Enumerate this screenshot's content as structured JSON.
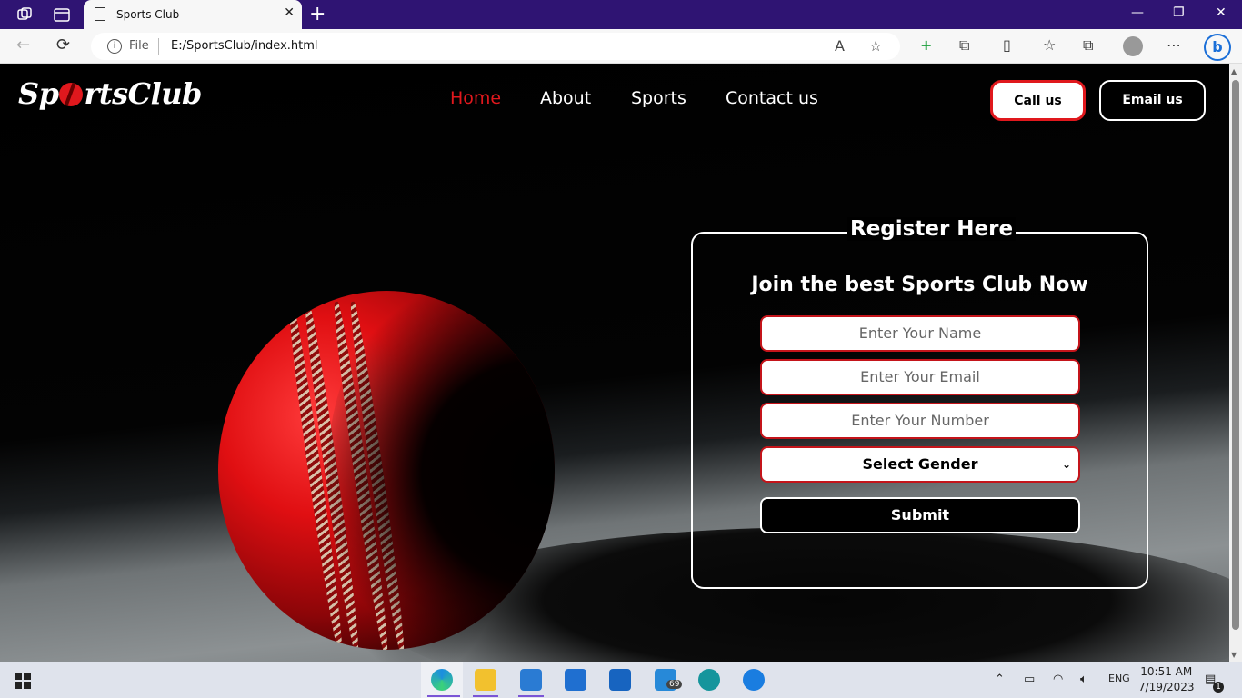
{
  "browser": {
    "tab_title": "Sports Club",
    "tab_close": "✕",
    "new_tab": "+",
    "address_scheme": "File",
    "address_url": "E:/SportsClub/index.html",
    "window_controls": {
      "minimize": "—",
      "restore": "❐",
      "close": "✕"
    }
  },
  "site": {
    "logo_pre": "Sp",
    "logo_post": "rtsClub",
    "nav": [
      {
        "label": "Home",
        "active": true
      },
      {
        "label": "About"
      },
      {
        "label": "Sports"
      },
      {
        "label": "Contact us"
      }
    ],
    "call_button": "Call us",
    "email_button": "Email us",
    "form": {
      "legend": "Register Here",
      "subtitle": "Join the best Sports Club Now",
      "name_placeholder": "Enter Your Name",
      "email_placeholder": "Enter Your Email",
      "number_placeholder": "Enter Your Number",
      "gender_selected": "Select Gender",
      "submit_label": "Submit"
    }
  },
  "taskbar": {
    "mail_badge": "69",
    "language": "ENG",
    "time": "10:51 AM",
    "date": "7/19/2023",
    "notification_count": "1"
  },
  "colors": {
    "accent_red": "#e0181d",
    "titlebar": "#2f1473"
  }
}
